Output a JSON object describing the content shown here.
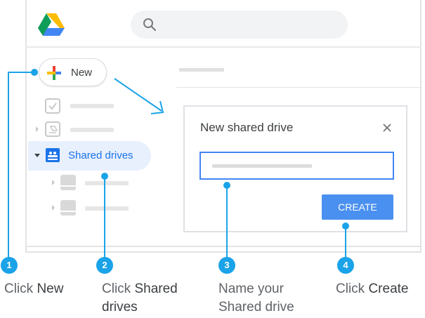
{
  "search": {
    "icon": "search-icon"
  },
  "new_button": {
    "label": "New",
    "icon": "plus-icon"
  },
  "sidebar": {
    "shared_drives_label": "Shared drives",
    "icons": [
      "priority-icon",
      "my-drive-icon",
      "shared-drives-icon",
      "drive-item-icon",
      "drive-item-icon"
    ]
  },
  "dialog": {
    "title": "New shared drive",
    "create_label": "CREATE"
  },
  "steps": [
    {
      "number": "1",
      "text": "Click ",
      "bold": "New",
      "bold2": ""
    },
    {
      "number": "2",
      "text": "Click ",
      "bold": "Shared",
      "bold2": "drives"
    },
    {
      "number": "3",
      "text": "Name your",
      "bold": "",
      "bold2": "Shared drive"
    },
    {
      "number": "4",
      "text": "Click ",
      "bold": "Create",
      "bold2": ""
    }
  ],
  "colors": {
    "accent": "#1aa3e8",
    "blue": "#4285f4",
    "selected_bg": "#e8f0fe"
  }
}
